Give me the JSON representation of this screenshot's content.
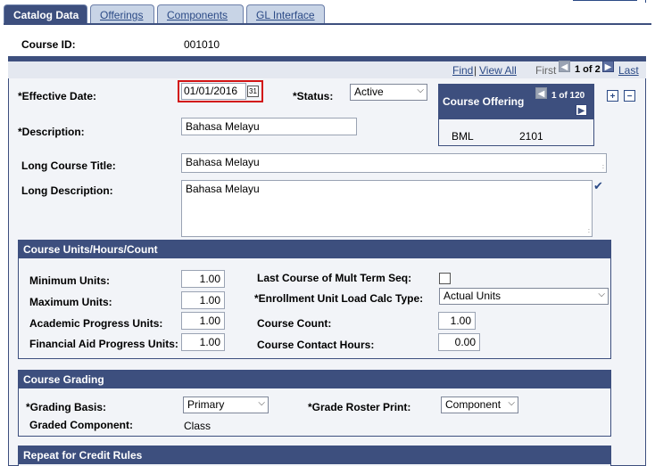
{
  "tabs": [
    "Catalog Data",
    "Offerings",
    "Components",
    "GL Interface"
  ],
  "course_id_label": "Course ID:",
  "course_id": "001010",
  "nav": {
    "find": "Find",
    "view_all": "View All",
    "first": "First",
    "position": "1 of 2",
    "last": "Last"
  },
  "effective_date_label": "*Effective Date:",
  "effective_date": "01/01/2016",
  "status_label": "*Status:",
  "status": "Active",
  "offering": {
    "title": "Course Offering",
    "position": "1 of 120",
    "subject": "BML",
    "catalog": "2101"
  },
  "description_label": "*Description:",
  "description": "Bahasa Melayu",
  "long_title_label": "Long Course Title:",
  "long_title": "Bahasa Melayu",
  "long_desc_label": "Long Description:",
  "long_desc": "Bahasa Melayu",
  "units": {
    "title": "Course Units/Hours/Count",
    "min_label": "Minimum Units:",
    "min": "1.00",
    "max_label": "Maximum Units:",
    "max": "1.00",
    "acad_label": "Academic Progress Units:",
    "acad": "1.00",
    "fin_label": "Financial Aid Progress Units:",
    "fin": "1.00",
    "last_course_label": "Last Course of Mult Term Seq:",
    "load_calc_label": "*Enrollment Unit Load Calc Type:",
    "load_calc": "Actual Units",
    "count_label": "Course Count:",
    "count": "1.00",
    "contact_label": "Course Contact Hours:",
    "contact": "0.00"
  },
  "grading": {
    "title": "Course Grading",
    "basis_label": "*Grading Basis:",
    "basis": "Primary",
    "roster_label": "*Grade Roster Print:",
    "roster": "Component",
    "component_label": "Graded Component:",
    "component": "Class"
  },
  "repeat": {
    "title": "Repeat for Credit Rules"
  }
}
